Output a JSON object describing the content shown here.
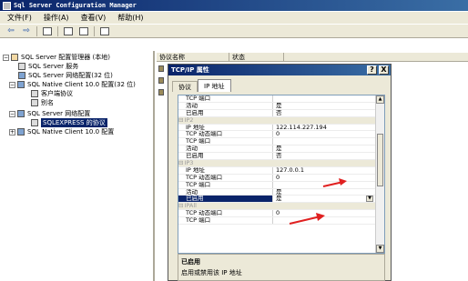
{
  "window": {
    "title": "Sql Server Configuration Manager"
  },
  "menu": [
    {
      "label": "文件(F)"
    },
    {
      "label": "操作(A)"
    },
    {
      "label": "查看(V)"
    },
    {
      "label": "帮助(H)"
    }
  ],
  "toolbar": {
    "icons": [
      "back-arrow-icon",
      "forward-arrow-icon",
      "up-folder-icon",
      "properties-icon",
      "export-icon",
      "help-icon"
    ]
  },
  "tree": {
    "root": "SQL Server 配置管理器 (本地)",
    "services": "SQL Server 服务",
    "netconfig32": "SQL Server 网络配置(32 位)",
    "native32": "SQL Native Client 10.0 配置(32 位)",
    "client_protocols": "客户端协议",
    "aliases": "别名",
    "netconfig": "SQL Server 网络配置",
    "sqlexpress": "SQLEXPRESS 的协议",
    "native": "SQL Native Client 10.0 配置"
  },
  "list": {
    "col1": "协议名称",
    "col2": "状态"
  },
  "dialog": {
    "title": "TCP/IP 属性",
    "help": "?",
    "close": "X",
    "tabs": [
      "协议",
      "IP 地址"
    ],
    "rows": [
      {
        "k": "TCP 端口",
        "v": ""
      },
      {
        "k": "活动",
        "v": "是"
      },
      {
        "k": "已启用",
        "v": "否"
      },
      {
        "section": "IP2"
      },
      {
        "k": "IP 地址",
        "v": "122.114.227.194"
      },
      {
        "k": "TCP 动态端口",
        "v": "0"
      },
      {
        "k": "TCP 端口",
        "v": ""
      },
      {
        "k": "活动",
        "v": "是"
      },
      {
        "k": "已启用",
        "v": "否"
      },
      {
        "section": "IP3"
      },
      {
        "k": "IP 地址",
        "v": "127.0.0.1"
      },
      {
        "k": "TCP 动态端口",
        "v": "0"
      },
      {
        "k": "TCP 端口",
        "v": ""
      },
      {
        "k": "活动",
        "v": "是"
      },
      {
        "k": "已启用",
        "v": "是",
        "selected": true
      },
      {
        "section": "IPAll"
      },
      {
        "k": "TCP 动态端口",
        "v": "0"
      },
      {
        "k": "TCP 端口",
        "v": ""
      }
    ],
    "desc_title": "已启用",
    "desc_text": "启用或禁用该 IP 地址"
  },
  "colors": {
    "title_bar": "#0a246a",
    "chrome": "#ece9d8",
    "selection": "#0a246a",
    "arrow": "#e02020"
  }
}
